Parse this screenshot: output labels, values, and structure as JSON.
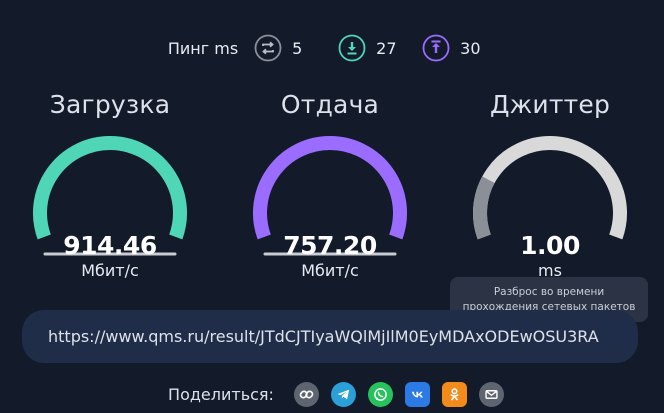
{
  "ping": {
    "label": "Пинг ms",
    "ping_value": "5",
    "download_value": "27",
    "upload_value": "30"
  },
  "gauges": {
    "download": {
      "title": "Загрузка",
      "value": "914.46",
      "unit": "Мбит/с",
      "color": "#4fd6b6",
      "fill": 1.0
    },
    "upload": {
      "title": "Отдача",
      "value": "757.20",
      "unit": "Мбит/с",
      "color": "#9a6cff",
      "fill": 1.0
    },
    "jitter": {
      "title": "Джиттер",
      "value": "1.00",
      "unit": "ms",
      "color": "#8a8f98",
      "fill": 0.22
    }
  },
  "tooltip": {
    "line1": "Разброс во времени",
    "line2": "прохождения сетевых пакетов"
  },
  "result_url": "https://www.qms.ru/result/JTdCJTIyaWQlMjIlM0EyMDAxODEwOSU3RA",
  "share": {
    "label": "Поделиться:",
    "icons": [
      "link-icon",
      "telegram-icon",
      "whatsapp-icon",
      "vk-icon",
      "odnoklassniki-icon",
      "email-icon"
    ]
  }
}
